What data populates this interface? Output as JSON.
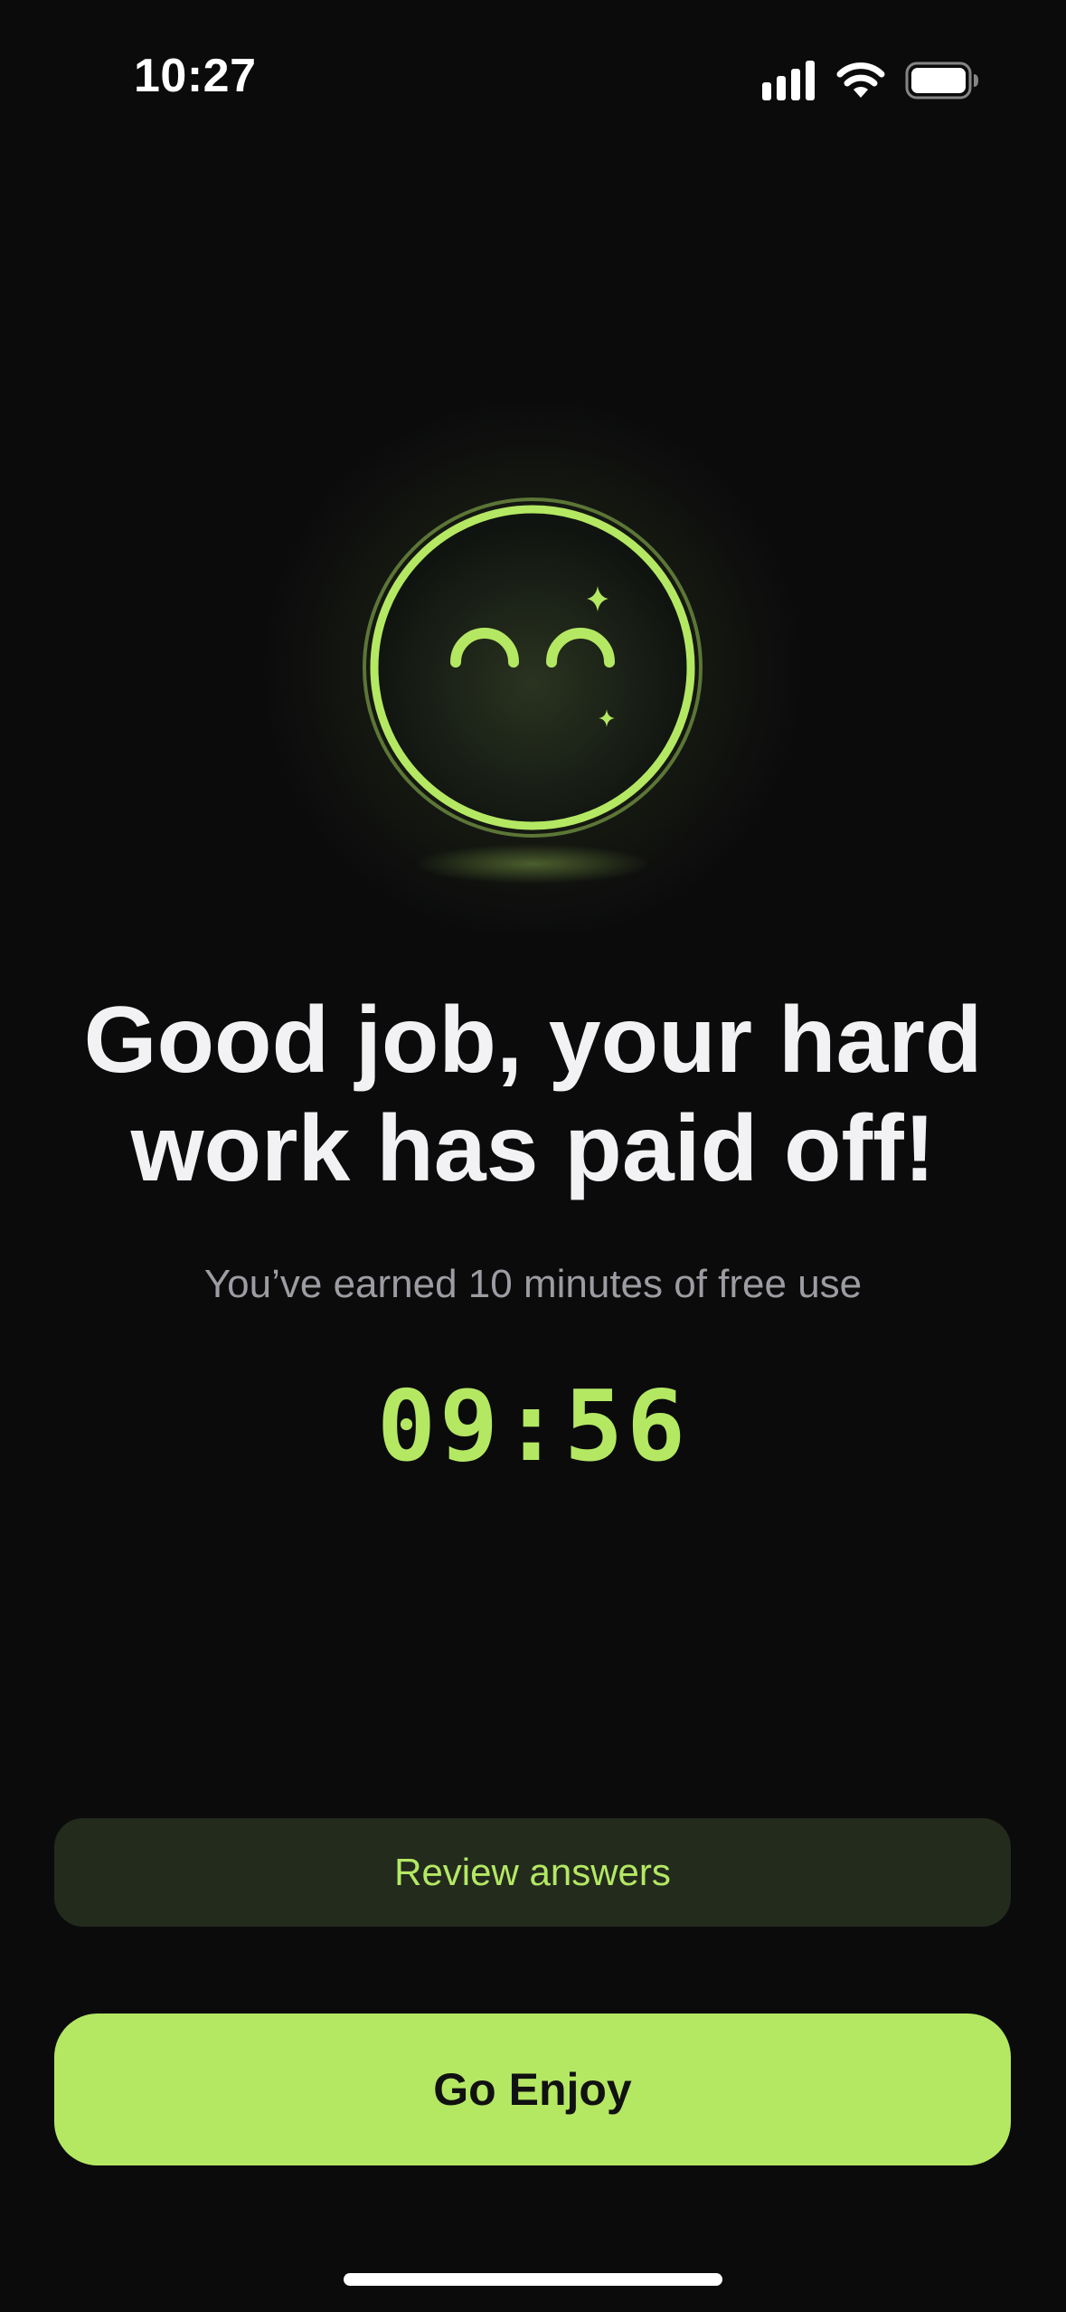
{
  "status_bar": {
    "time": "10:27",
    "icons": [
      "cellular-signal-icon",
      "wifi-icon",
      "battery-icon"
    ]
  },
  "hero": {
    "icon": "happy-face-icon",
    "decorations": [
      "sparkle-icon",
      "sparkle-icon"
    ]
  },
  "headline": "Good job, your hard work has paid off!",
  "subtitle": "You’ve earned 10 minutes of free use",
  "timer": "09:56",
  "buttons": {
    "review_label": "Review answers",
    "primary_label": "Go Enjoy"
  },
  "colors": {
    "background": "#0b0b0c",
    "accent": "#b4e863",
    "secondary_button_bg": "#232b1d",
    "headline_text": "#f2f2f4",
    "subtitle_text": "#9c9ca2"
  }
}
